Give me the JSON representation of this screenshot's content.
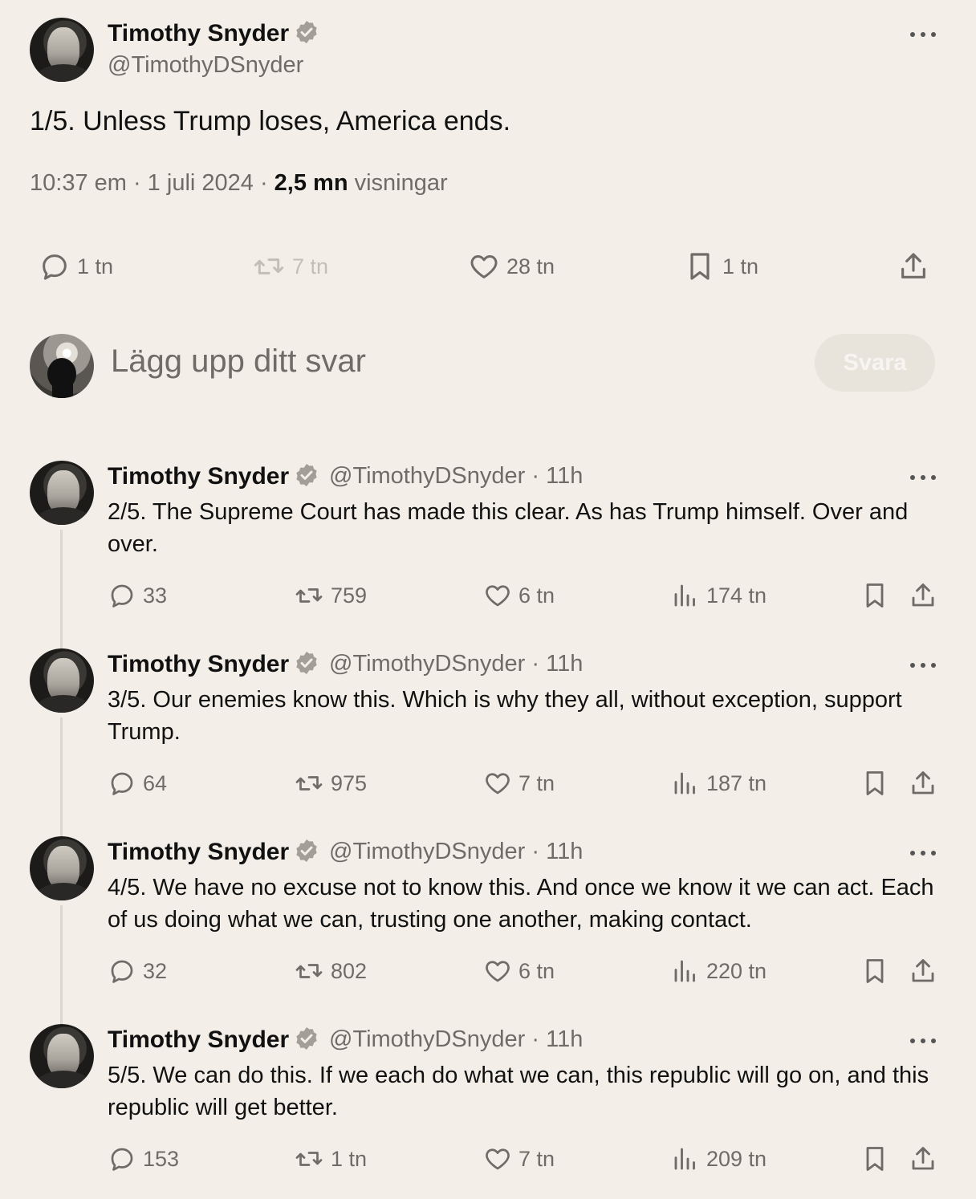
{
  "main_tweet": {
    "author_name": "Timothy Snyder",
    "handle": "@TimothyDSnyder",
    "text": "1/5.  Unless Trump loses, America ends.",
    "time": "10:37 em · 1 juli 2024 · ",
    "views_count": "2,5 mn",
    "views_label": " visningar",
    "replies": "1 tn",
    "retweets": "7 tn",
    "likes": "28 tn",
    "bookmarks": "1 tn"
  },
  "reply_box": {
    "placeholder": "Lägg upp ditt svar",
    "button": "Svara"
  },
  "thread": [
    {
      "author_name": "Timothy Snyder",
      "handle_time": "@TimothyDSnyder · 11h",
      "text": "2/5.  The Supreme Court has made this clear. As has Trump himself. Over and over.",
      "replies": "33",
      "retweets": "759",
      "likes": "6 tn",
      "views": "174 tn"
    },
    {
      "author_name": "Timothy Snyder",
      "handle_time": "@TimothyDSnyder · 11h",
      "text": "3/5.  Our enemies know this. Which is why they all, without exception, support Trump.",
      "replies": "64",
      "retweets": "975",
      "likes": "7 tn",
      "views": "187 tn"
    },
    {
      "author_name": "Timothy Snyder",
      "handle_time": "@TimothyDSnyder · 11h",
      "text": "4/5.  We have no excuse not to know this. And once we know it we can act. Each of us doing what we can, trusting one another, making contact.",
      "replies": "32",
      "retweets": "802",
      "likes": "6 tn",
      "views": "220 tn"
    },
    {
      "author_name": "Timothy Snyder",
      "handle_time": "@TimothyDSnyder · 11h",
      "text": "5/5.  We can do this. If we each do what we can, this republic will go on, and this republic will get better.",
      "replies": "153",
      "retweets": "1 tn",
      "likes": "7 tn",
      "views": "209 tn"
    }
  ],
  "colors": {
    "background": "#f3efe8",
    "muted_text": "#6f6b66",
    "badge": "#a39e96"
  }
}
